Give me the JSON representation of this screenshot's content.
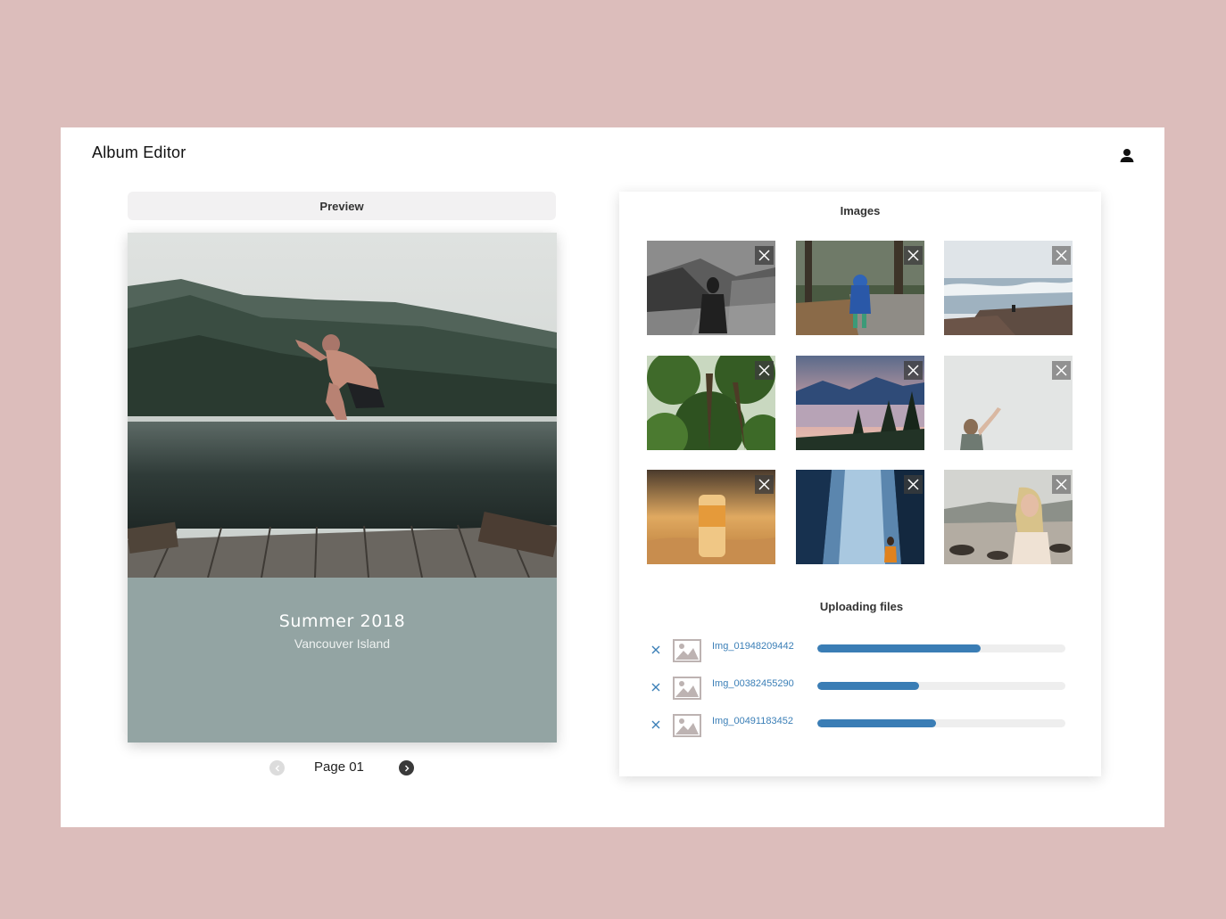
{
  "app": {
    "title": "Album Editor"
  },
  "header": {
    "user_icon": "user-icon"
  },
  "preview": {
    "header_label": "Preview",
    "caption_title": "Summer 2018",
    "caption_subtitle": "Vancouver Island",
    "page_label": "Page 01"
  },
  "images": {
    "title": "Images",
    "items": [
      {
        "subject": "woman-by-rocks-bw"
      },
      {
        "subject": "child-on-forest-path"
      },
      {
        "subject": "ocean-waves-rocky-shore"
      },
      {
        "subject": "tall-trees-canopy"
      },
      {
        "subject": "mountain-lake-sunset"
      },
      {
        "subject": "person-waving-foggy-sky"
      },
      {
        "subject": "beer-can-on-sand"
      },
      {
        "subject": "waterfall-with-hiker"
      },
      {
        "subject": "smiling-woman-on-beach"
      }
    ]
  },
  "uploads": {
    "title": "Uploading files",
    "files": [
      {
        "name": "Img_01948209442",
        "progress": 0.66
      },
      {
        "name": "Img_00382455290",
        "progress": 0.41
      },
      {
        "name": "Img_00491183452",
        "progress": 0.48
      }
    ]
  },
  "colors": {
    "background": "#dcbdbb",
    "caption_panel": "#93a4a3",
    "accent": "#3a7db5",
    "upload_text": "#3b7fb7"
  }
}
